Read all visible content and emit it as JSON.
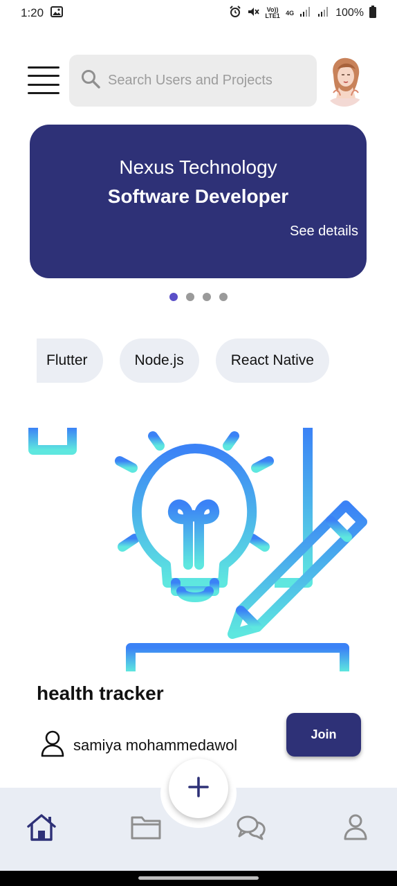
{
  "status_bar": {
    "time": "1:20",
    "network": "4G",
    "volte_label": "Vo)) LTE1",
    "battery": "100%"
  },
  "header": {
    "search_placeholder": "Search Users and Projects",
    "menu_icon": "hamburger-menu-icon",
    "search_icon": "search-icon",
    "avatar_icon": "user-avatar-illustration"
  },
  "banner": {
    "company": "Nexus Technology",
    "role": "Software Developer",
    "link_label": "See details",
    "color": "#2e3177",
    "page_count": 4,
    "active_page": 1
  },
  "chips": [
    "Flutter",
    "Node.js",
    "React Native"
  ],
  "project": {
    "title": "health tracker",
    "owner": "samiya mohammedawol",
    "join_label": "Join",
    "art_icon": "lightbulb-pencil-idea-illustration"
  },
  "bottom_nav": {
    "items": [
      {
        "name": "home",
        "icon": "home-icon",
        "active": true
      },
      {
        "name": "projects",
        "icon": "folder-icon",
        "active": false
      },
      {
        "name": "chats",
        "icon": "chat-icon",
        "active": false
      },
      {
        "name": "profile",
        "icon": "profile-icon",
        "active": false
      }
    ],
    "fab_icon": "plus-icon"
  },
  "colors": {
    "primary": "#2e3177",
    "accent_dot": "#5a4fc8",
    "chip_bg": "#ebeef4",
    "nav_bg": "#e9edf4",
    "art_gradient_top": "#3b82f6",
    "art_gradient_bottom": "#5ee7df"
  }
}
